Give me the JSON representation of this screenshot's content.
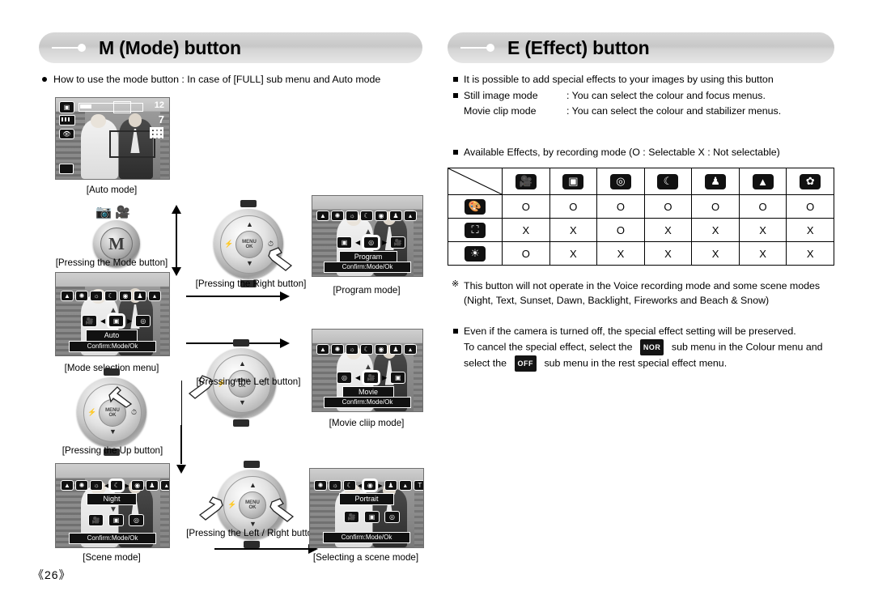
{
  "page": {
    "number": "《26》"
  },
  "left_section": {
    "title": "M (Mode) button",
    "intro": "How to use the mode button : In case of [FULL] sub menu and Auto mode",
    "captions": {
      "auto_mode": "[Auto mode]",
      "pressing_mode_button": "[Pressing the Mode button]",
      "mode_selection_menu": "[Mode selection menu]",
      "pressing_up_button": "[Pressing the Up button]",
      "scene_mode": "[Scene mode]",
      "pressing_right_button": "[Pressing the Right button]",
      "pressing_left_button": "[Pressing the Left button]",
      "pressing_left_right_button": "[Pressing the Left / Right button]",
      "program_mode": "[Program mode]",
      "movie_clip_mode": "[Movie cliip mode]",
      "selecting_scene_mode": "[Selecting a scene mode]"
    },
    "lcd": {
      "auto": {
        "counter": "12",
        "resolution": "7",
        "osd_icons": [
          "camera-icon",
          "battery-icon",
          "red-eye-icon",
          "card-icon"
        ]
      },
      "mode_selection": {
        "scene_icons": [
          "landscape-night-icon",
          "fireworks-icon",
          "beach-snow-icon",
          "night-icon",
          "sunset-icon",
          "portrait-icon",
          "landscape-icon"
        ],
        "mode_icons": [
          "movie-icon",
          "auto-icon",
          "program-icon"
        ],
        "selected_label": "Auto",
        "confirm_label": "Confirm:Mode/Ok"
      },
      "scene": {
        "scene_icons": [
          "landscape-night-icon",
          "fireworks-icon",
          "beach-snow-icon",
          "night-icon",
          "sunset-icon",
          "portrait-icon",
          "landscape-icon"
        ],
        "mode_icons": [
          "movie-icon",
          "auto-icon",
          "program-icon"
        ],
        "selected_label": "Night",
        "confirm_label": "Confirm:Mode/Ok"
      },
      "program": {
        "scene_icons": [
          "landscape-night-icon",
          "fireworks-icon",
          "beach-snow-icon",
          "night-icon",
          "sunset-icon",
          "portrait-icon",
          "landscape-icon"
        ],
        "mode_icons": [
          "auto-icon",
          "program-icon",
          "movie-icon"
        ],
        "selected_label": "Program",
        "confirm_label": "Confirm:Mode/Ok"
      },
      "movie": {
        "scene_icons": [
          "landscape-night-icon",
          "fireworks-icon",
          "beach-snow-icon",
          "night-icon",
          "sunset-icon",
          "portrait-icon",
          "landscape-icon"
        ],
        "mode_icons": [
          "program-icon",
          "movie-icon",
          "auto-icon"
        ],
        "selected_label": "Movie",
        "confirm_label": "Confirm:Mode/Ok"
      },
      "scene_select": {
        "scene_icons": [
          "fireworks-icon",
          "beach-snow-icon",
          "night-icon",
          "sunset-icon",
          "portrait-icon",
          "landscape-icon",
          "text-icon"
        ],
        "mode_icons": [
          "movie-icon",
          "auto-icon",
          "program-icon"
        ],
        "selected_label": "Portrait",
        "confirm_label": "Confirm:Mode/Ok"
      }
    },
    "mode_button_glyph": "M"
  },
  "right_section": {
    "title": "E (Effect) button",
    "bullets": [
      "It is possible to add special effects to your images by using this button"
    ],
    "modes": [
      {
        "label": "Still image mode",
        "desc": ": You can select the colour and focus menus."
      },
      {
        "label": "Movie clip mode",
        "desc": ": You can select the colour and stabilizer menus."
      }
    ],
    "table_intro": "Available Effects, by recording mode (O : Selectable X : Not selectable)",
    "note": {
      "marker": "※",
      "line1": "This button will not operate in the Voice recording mode and some scene modes",
      "line2": "(Night, Text, Sunset, Dawn, Backlight, Fireworks and Beach & Snow)"
    },
    "preserve": {
      "line1": "Even if the camera is turned off, the special effect setting will be preserved.",
      "line2a": "To cancel the special effect, select the",
      "badge1": "NOR",
      "line2b": "sub menu in the Colour menu and",
      "line3a": "select the",
      "badge2": "OFF",
      "line3b": "sub menu in the rest special effect menu."
    }
  },
  "chart_data": {
    "type": "table",
    "title": "Available Effects, by recording mode",
    "columns": [
      "",
      "movie-icon",
      "auto-icon",
      "program-icon",
      "night-icon",
      "portrait-icon",
      "landscape-icon",
      "close-up-icon"
    ],
    "rows": [
      {
        "header": "colour-icon",
        "values": [
          "O",
          "O",
          "O",
          "O",
          "O",
          "O",
          "O"
        ]
      },
      {
        "header": "focus-icon",
        "values": [
          "X",
          "X",
          "O",
          "X",
          "X",
          "X",
          "X"
        ]
      },
      {
        "header": "stabilizer-icon",
        "values": [
          "O",
          "X",
          "X",
          "X",
          "X",
          "X",
          "X"
        ]
      }
    ]
  }
}
